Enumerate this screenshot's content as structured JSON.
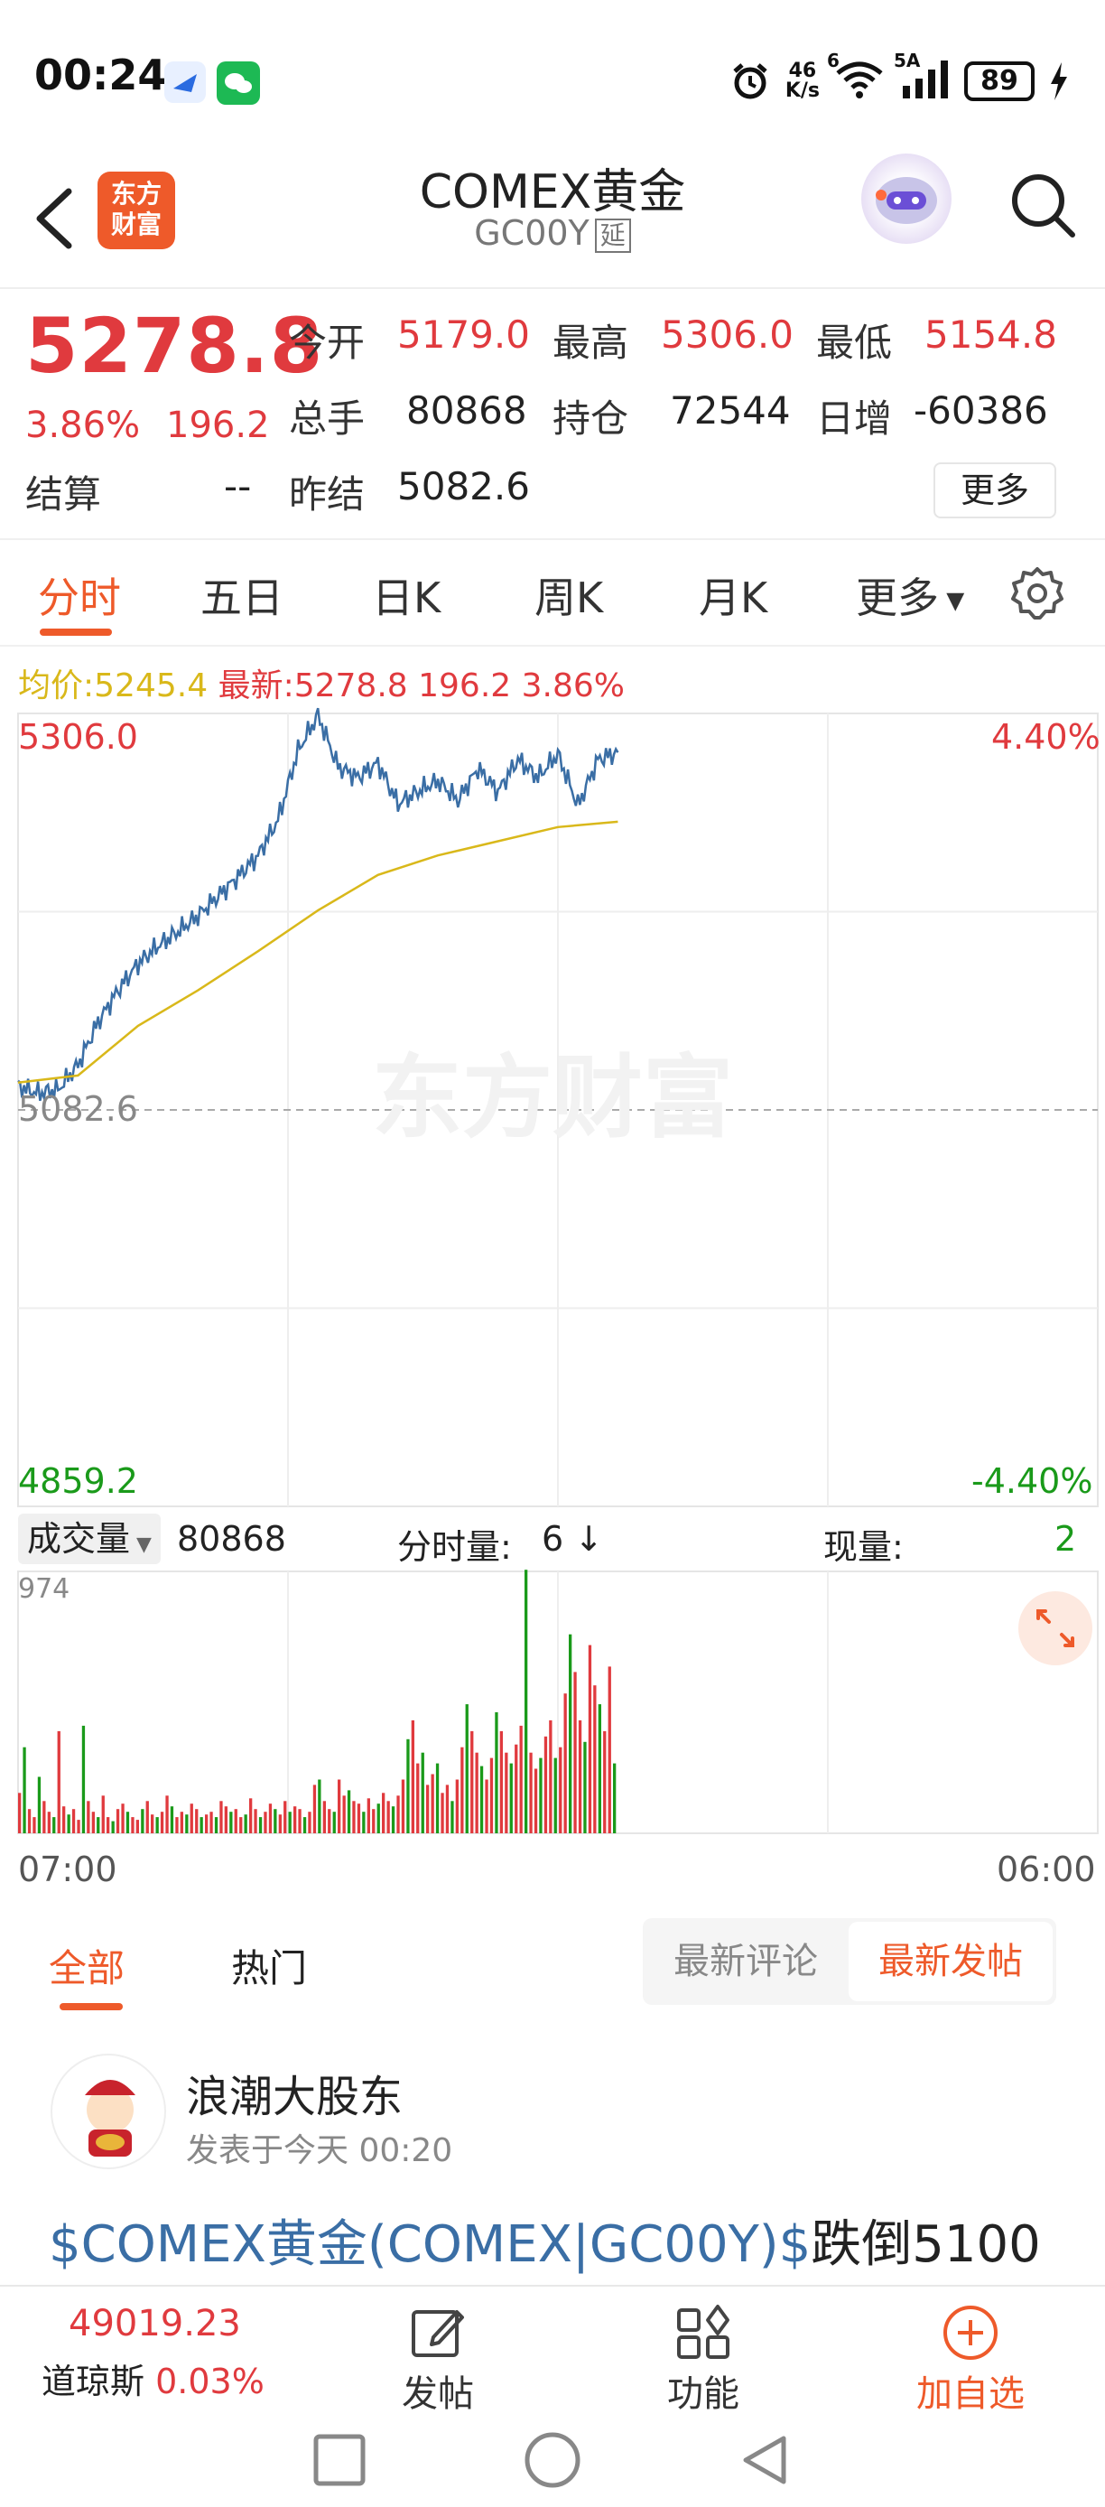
{
  "status_bar": {
    "time": "00:24",
    "net_speed_top": "46",
    "net_speed_bottom": "K/s",
    "wifi_badge": "6",
    "signal_badge": "5A",
    "battery": "89"
  },
  "header": {
    "logo_line1": "东方",
    "logo_line2": "财富",
    "title": "COMEX黄金",
    "code": "GC00Y",
    "delay_tag": "延"
  },
  "quote": {
    "price": "5278.8",
    "change_pct": "3.86%",
    "change": "196.2",
    "open_label": "今开",
    "open": "5179.0",
    "high_label": "最高",
    "high": "5306.0",
    "low_label": "最低",
    "low": "5154.8",
    "volume_label": "总手",
    "volume": "80868",
    "oi_label": "持仓",
    "oi": "72544",
    "daily_inc_label": "日增",
    "daily_inc": "-60386",
    "settle_label": "结算",
    "settle": "--",
    "prev_settle_label": "昨结",
    "prev_settle": "5082.6",
    "more_button": "更多"
  },
  "tabs": [
    "分时",
    "五日",
    "日K",
    "周K",
    "月K",
    "更多"
  ],
  "avg_line": {
    "avg_label": "均价:",
    "avg_value": "5245.4",
    "latest_label": "最新:",
    "latest_value": "5278.8",
    "latest_change": "196.2",
    "latest_pct": "3.86%"
  },
  "chart_labels": {
    "top_price": "5306.0",
    "top_pct": "4.40%",
    "mid_price": "5082.6",
    "bottom_price": "4859.2",
    "bottom_pct": "-4.40%",
    "watermark": "东方财富"
  },
  "colors": {
    "up": "#e03a3e",
    "down": "#1a9a1a",
    "price_line": "#3a6ea5",
    "avg_line": "#d9b81a",
    "accent": "#ee5a2a"
  },
  "chart_data": [
    {
      "type": "line",
      "series": [
        {
          "name": "最新",
          "x": [
            0,
            10,
            20,
            30,
            40,
            50,
            60,
            70,
            80,
            90,
            100,
            110,
            120,
            130,
            140,
            150,
            160,
            170,
            180,
            190,
            200,
            210,
            220,
            230,
            240,
            250,
            260,
            270,
            280,
            290,
            300
          ],
          "values": [
            5096,
            5092,
            5094,
            5108,
            5132,
            5150,
            5165,
            5175,
            5183,
            5192,
            5203,
            5214,
            5226,
            5246,
            5285,
            5305,
            5276,
            5270,
            5278,
            5255,
            5262,
            5268,
            5257,
            5275,
            5262,
            5280,
            5270,
            5283,
            5254,
            5280,
            5284
          ]
        },
        {
          "name": "均价",
          "x": [
            0,
            30,
            60,
            90,
            120,
            150,
            180,
            210,
            240,
            270,
            300
          ],
          "values": [
            5098,
            5102,
            5130,
            5150,
            5172,
            5195,
            5215,
            5226,
            5234,
            5242,
            5245
          ]
        }
      ],
      "ylim": [
        4859.2,
        5306.0
      ],
      "grid": true
    },
    {
      "type": "bar",
      "title": "成交量",
      "ylim": [
        0,
        974
      ],
      "values": [
        150,
        320,
        90,
        60,
        210,
        120,
        80,
        60,
        380,
        100,
        70,
        90,
        50,
        400,
        120,
        80,
        60,
        140,
        60,
        45,
        90,
        110,
        80,
        60,
        50,
        90,
        120,
        70,
        60,
        80,
        140,
        100,
        60,
        80,
        70,
        110,
        90,
        60,
        70,
        80,
        60,
        120,
        100,
        80,
        90,
        60,
        70,
        130,
        90,
        60,
        80,
        110,
        90,
        70,
        120,
        80,
        100,
        90,
        60,
        80,
        180,
        200,
        120,
        90,
        80,
        200,
        140,
        160,
        120,
        110,
        80,
        130,
        90,
        110,
        150,
        120,
        100,
        140,
        200,
        350,
        420,
        260,
        300,
        180,
        220,
        260,
        150,
        180,
        120,
        200,
        320,
        480,
        380,
        300,
        250,
        200,
        280,
        450,
        380,
        300,
        260,
        330,
        400,
        980,
        300,
        240,
        280,
        360,
        420,
        280,
        320,
        520,
        740,
        600,
        420,
        340,
        700,
        550,
        480,
        380,
        620,
        260
      ],
      "bar_colors_pattern": [
        "up",
        "down"
      ],
      "grid": true
    }
  ],
  "volume_row": {
    "select_label": "成交量",
    "volume": "80868",
    "tick_label": "分时量:",
    "tick_value": "6",
    "tick_arrow": "↓",
    "current_label": "现量:",
    "current_value": "2",
    "y_max": "974"
  },
  "time_axis": {
    "start": "07:00",
    "end": "06:00"
  },
  "comments": {
    "tab_all": "全部",
    "tab_hot": "热门",
    "seg_latest_comment": "最新评论",
    "seg_latest_post": "最新发帖"
  },
  "post": {
    "author": "浪潮大股东",
    "time": "发表于今天 00:20",
    "link_text": "$COMEX黄金(COMEX|GC00Y)$",
    "body_text": "跌倒5100"
  },
  "bottom_bar": {
    "index_value": "49019.23",
    "index_name": "道琼斯",
    "index_pct": "0.03%",
    "post_label": "发帖",
    "function_label": "功能",
    "add_watch_label": "加自选"
  }
}
